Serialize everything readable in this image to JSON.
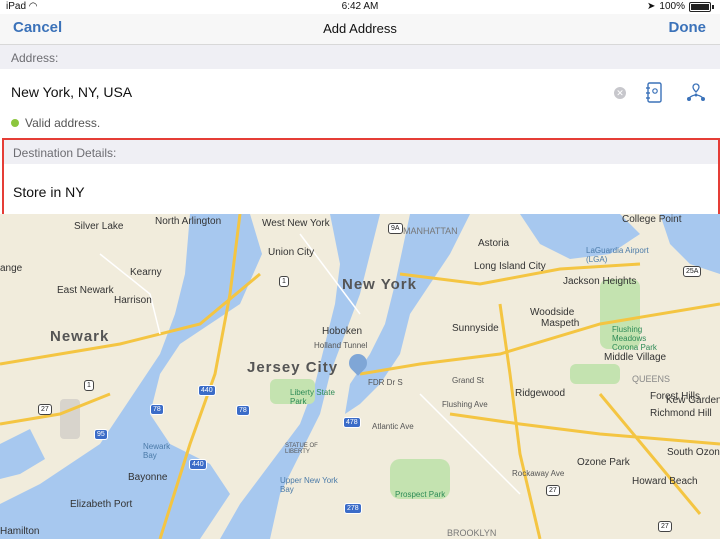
{
  "status_bar": {
    "device": "iPad",
    "time": "6:42 AM",
    "battery": "100%"
  },
  "nav": {
    "cancel": "Cancel",
    "title": "Add Address",
    "done": "Done"
  },
  "address_section": {
    "header": "Address:",
    "value": "New York, NY, USA",
    "validation": "Valid address.",
    "valid_color": "#8cc63e"
  },
  "destination_section": {
    "header": "Destination Details:",
    "value": "Store in NY",
    "highlight_color": "#e53d36"
  },
  "map": {
    "labels": {
      "north_arlington": "North Arlington",
      "west_new_york": "West New York",
      "manhattan": "MANHATTAN",
      "college_point": "College Point",
      "silver_lake": "Silver Lake",
      "union_city": "Union City",
      "astoria": "Astoria",
      "laguardia": "LaGuardia Airport (LGA)",
      "range": "ange",
      "kearny": "Kearny",
      "new_york": "New York",
      "long_island_city": "Long Island City",
      "jackson_heights": "Jackson Heights",
      "east_newark": "East Newark",
      "harrison": "Harrison",
      "woodside": "Woodside",
      "maspeth": "Maspeth",
      "newark": "Newark",
      "hoboken": "Hoboken",
      "sunnyside": "Sunnyside",
      "flushing_meadows": "Flushing Meadows Corona Park",
      "holland_tunnel": "Holland Tunnel",
      "middle_village": "Middle Village",
      "jersey_city": "Jersey City",
      "fdr": "FDR Dr S",
      "grand_st": "Grand St",
      "queens": "QUEENS",
      "liberty_state_park": "Liberty State Park",
      "ridgewood": "Ridgewood",
      "forest_hills": "Forest Hills",
      "kew_gardens": "Kew Gardens",
      "flushing_ave": "Flushing Ave",
      "richmond_hill": "Richmond Hill",
      "newark_bay": "Newark Bay",
      "statue_of_liberty": "STATUE OF LIBERTY",
      "atlantic_ave": "Atlantic Ave",
      "upper_ny_bay": "Upper New York Bay",
      "south_ozone": "South Ozone",
      "bayonne": "Bayonne",
      "ozone_park": "Ozone Park",
      "howard_beach": "Howard Beach",
      "prospect_park": "Prospect Park",
      "elizabeth_port": "Elizabeth Port",
      "brooklyn": "BROOKLYN",
      "rockaway_ave": "Rockaway Ave",
      "hamilton": "Hamilton"
    },
    "shields": {
      "i9a": "9A",
      "i1a": "1",
      "i25a": "25A",
      "i1b": "1",
      "i440a": "440",
      "i27a": "27",
      "i78a": "78",
      "i78b": "78",
      "i478": "478",
      "i95": "95",
      "i440b": "440",
      "i278": "278",
      "i27b": "27",
      "i27c": "27"
    }
  }
}
